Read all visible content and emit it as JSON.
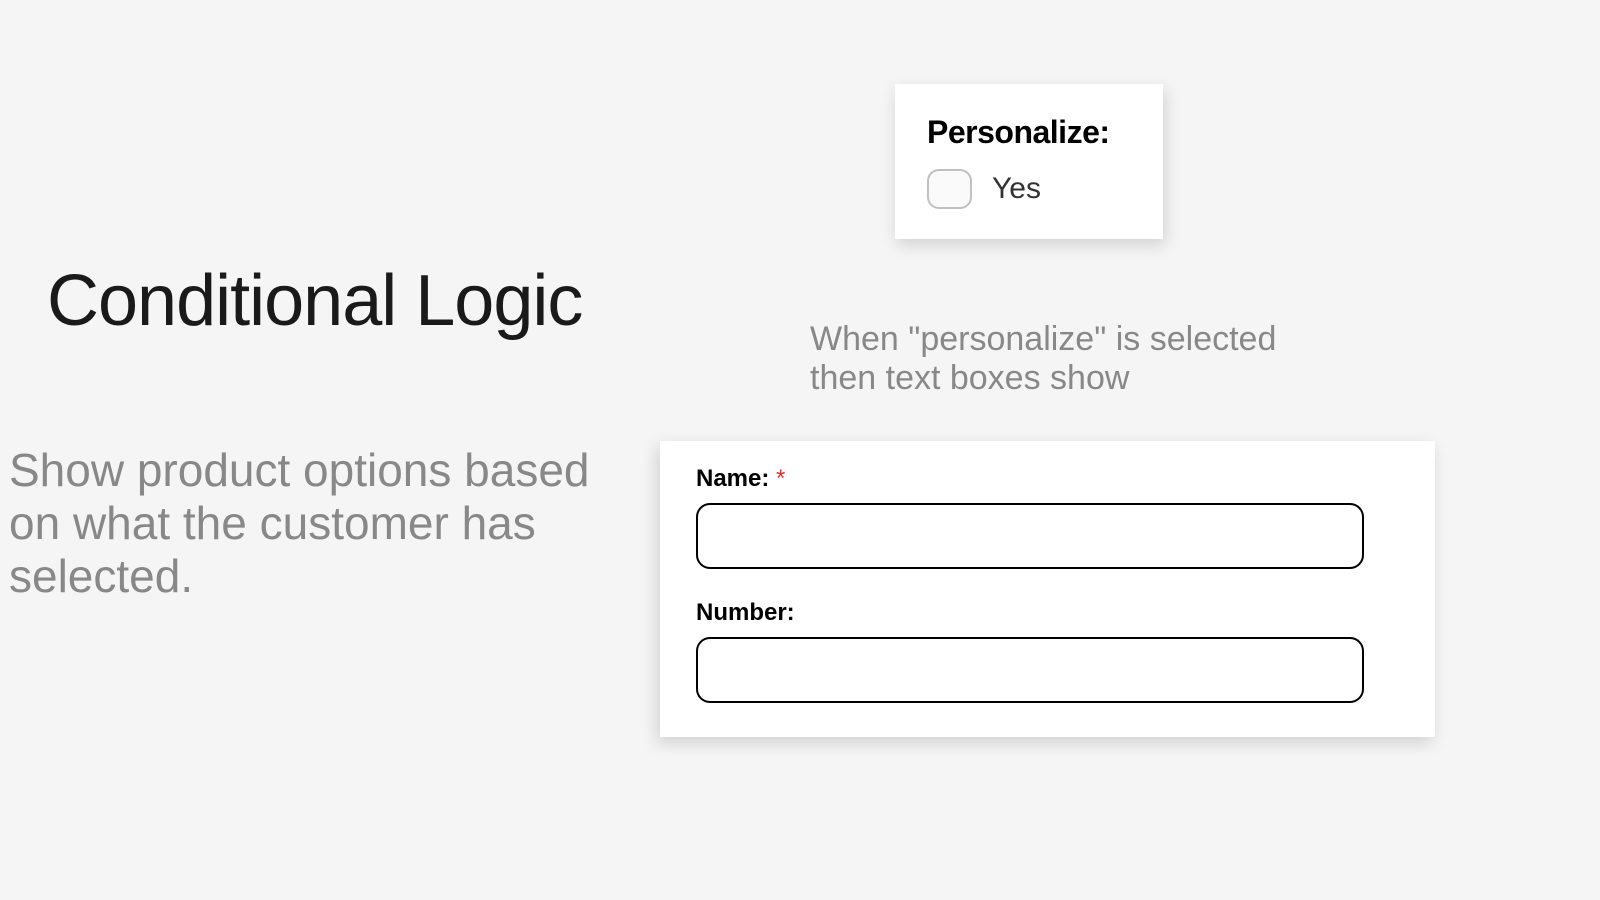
{
  "heading": "Conditional Logic",
  "subheading": "Show product options based on what the customer has selected.",
  "personalize": {
    "title": "Personalize:",
    "optionLabel": "Yes"
  },
  "explanation": "When \"personalize\" is selected then text boxes show",
  "form": {
    "nameLabel": "Name: ",
    "requiredMark": "*",
    "numberLabel": "Number:"
  }
}
